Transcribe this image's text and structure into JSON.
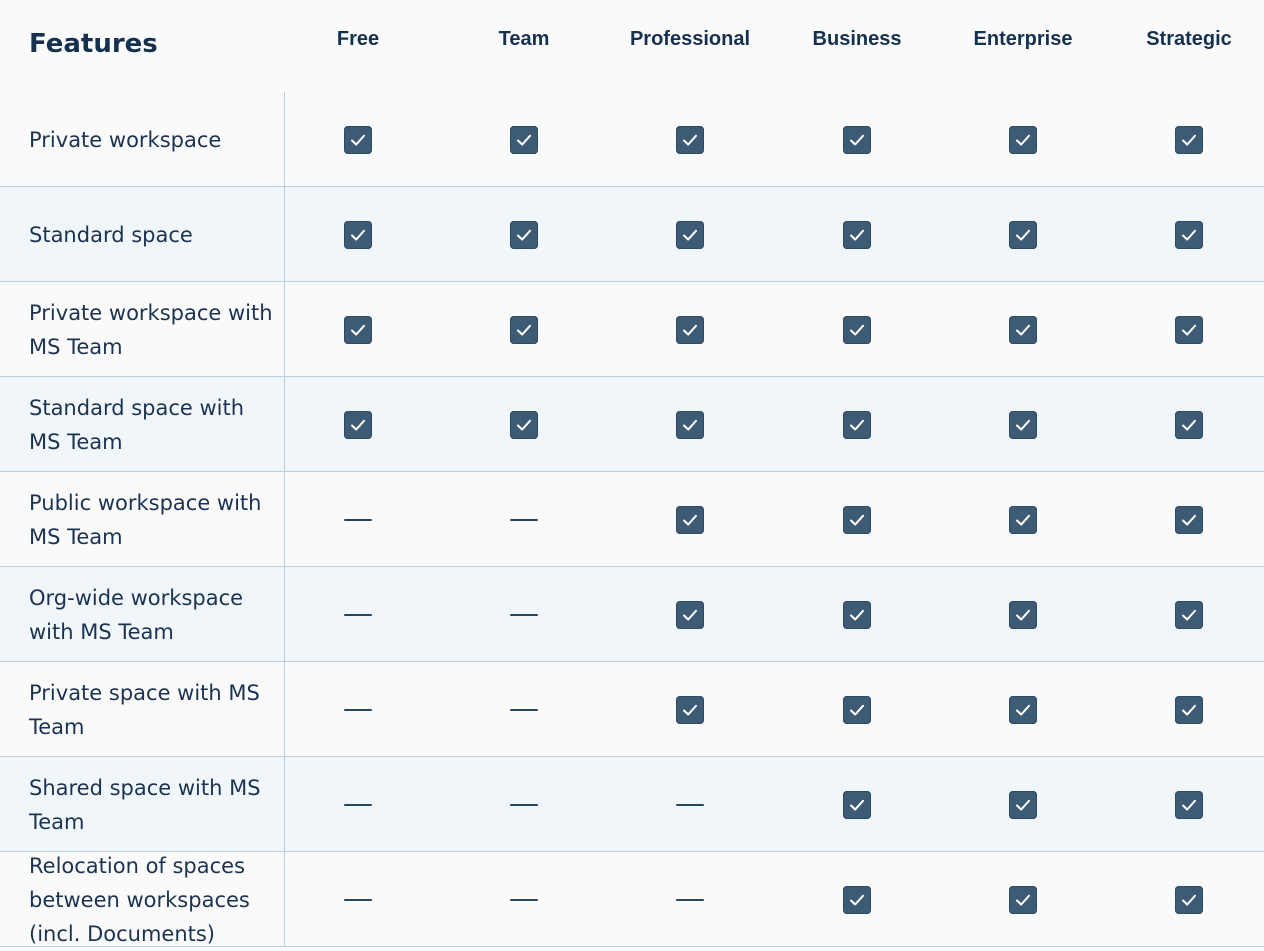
{
  "header": {
    "features_label": "Features",
    "plans": [
      "Free",
      "Team",
      "Professional",
      "Business",
      "Enterprise",
      "Strategic"
    ]
  },
  "rows": [
    {
      "label": "Private workspace",
      "values": [
        true,
        true,
        true,
        true,
        true,
        true
      ]
    },
    {
      "label": "Standard space",
      "values": [
        true,
        true,
        true,
        true,
        true,
        true
      ]
    },
    {
      "label": "Private workspace with MS Team",
      "values": [
        true,
        true,
        true,
        true,
        true,
        true
      ]
    },
    {
      "label": "Standard space with MS Team",
      "values": [
        true,
        true,
        true,
        true,
        true,
        true
      ]
    },
    {
      "label": "Public workspace with MS Team",
      "values": [
        false,
        false,
        true,
        true,
        true,
        true
      ]
    },
    {
      "label": "Org-wide workspace with MS Team",
      "values": [
        false,
        false,
        true,
        true,
        true,
        true
      ]
    },
    {
      "label": "Private space with MS Team",
      "values": [
        false,
        false,
        true,
        true,
        true,
        true
      ]
    },
    {
      "label": "Shared space with MS Team",
      "values": [
        false,
        false,
        false,
        true,
        true,
        true
      ]
    },
    {
      "label": "Relocation of spaces between workspaces (incl. Documents)",
      "values": [
        false,
        false,
        false,
        true,
        true,
        true
      ]
    }
  ],
  "icons": {
    "included": "checkbox-checked-icon",
    "not_included": "dash-icon"
  },
  "colors": {
    "check_fill": "#3e5b75",
    "text": "#16304f",
    "row_alt": "#f1f6fb",
    "divider": "#b9cfe0"
  }
}
